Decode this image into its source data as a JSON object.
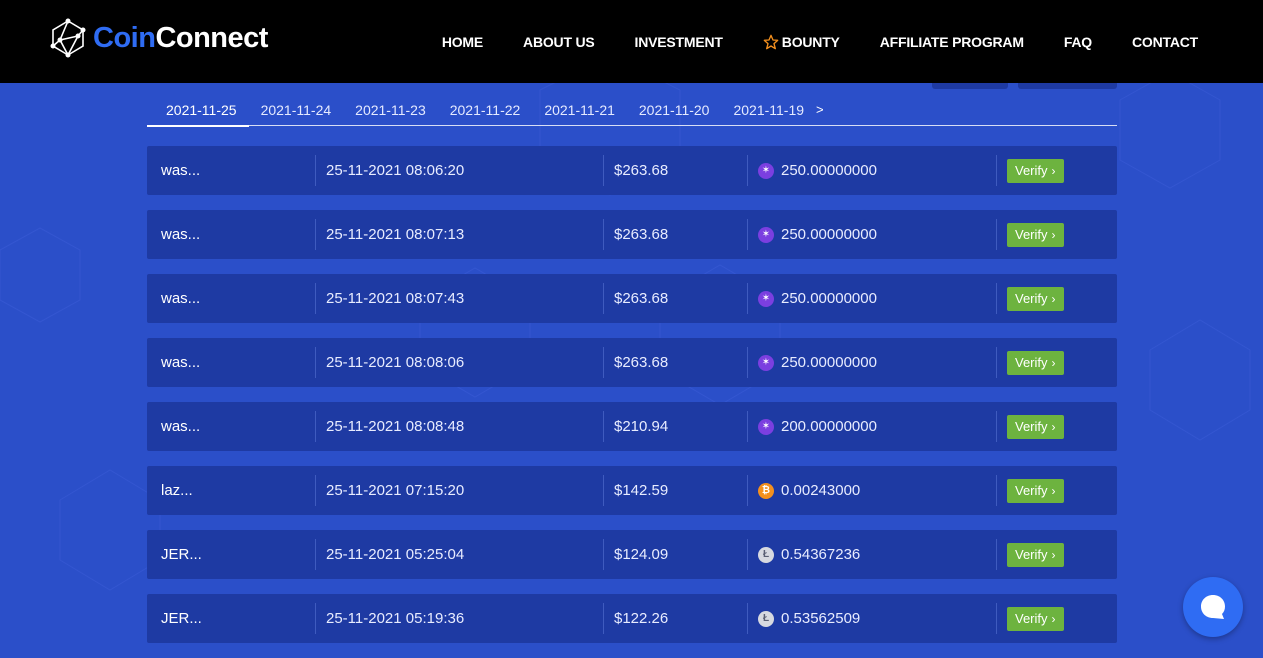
{
  "brand": {
    "part1": "Coin",
    "part2": "Connect"
  },
  "nav": [
    {
      "label": "HOME",
      "icon": ""
    },
    {
      "label": "ABOUT US",
      "icon": ""
    },
    {
      "label": "INVESTMENT",
      "icon": ""
    },
    {
      "label": "BOUNTY",
      "icon": "star-icon"
    },
    {
      "label": "AFFILIATE PROGRAM",
      "icon": ""
    },
    {
      "label": "FAQ",
      "icon": ""
    },
    {
      "label": "CONTACT",
      "icon": ""
    }
  ],
  "tabs": {
    "dates": [
      "2021-11-25",
      "2021-11-24",
      "2021-11-23",
      "2021-11-22",
      "2021-11-21",
      "2021-11-20",
      "2021-11-19"
    ],
    "active": "2021-11-25",
    "next_label": ">"
  },
  "transactions": [
    {
      "user": "was...",
      "time": "25-11-2021 08:06:20",
      "usd": "$263.68",
      "coin": "xlm",
      "amount": "250.00000000",
      "verify": "Verify"
    },
    {
      "user": "was...",
      "time": "25-11-2021 08:07:13",
      "usd": "$263.68",
      "coin": "xlm",
      "amount": "250.00000000",
      "verify": "Verify"
    },
    {
      "user": "was...",
      "time": "25-11-2021 08:07:43",
      "usd": "$263.68",
      "coin": "xlm",
      "amount": "250.00000000",
      "verify": "Verify"
    },
    {
      "user": "was...",
      "time": "25-11-2021 08:08:06",
      "usd": "$263.68",
      "coin": "xlm",
      "amount": "250.00000000",
      "verify": "Verify"
    },
    {
      "user": "was...",
      "time": "25-11-2021 08:08:48",
      "usd": "$210.94",
      "coin": "xlm",
      "amount": "200.00000000",
      "verify": "Verify"
    },
    {
      "user": "laz...",
      "time": "25-11-2021 07:15:20",
      "usd": "$142.59",
      "coin": "btc",
      "amount": "0.00243000",
      "verify": "Verify"
    },
    {
      "user": "JER...",
      "time": "25-11-2021 05:25:04",
      "usd": "$124.09",
      "coin": "ltc",
      "amount": "0.54367236",
      "verify": "Verify"
    },
    {
      "user": "JER...",
      "time": "25-11-2021 05:19:36",
      "usd": "$122.26",
      "coin": "ltc",
      "amount": "0.53562509",
      "verify": "Verify"
    }
  ],
  "coin_icons": {
    "xlm": "stellar-icon",
    "btc": "bitcoin-icon",
    "ltc": "litecoin-icon"
  },
  "colors": {
    "background": "#2b4fc9",
    "row": "#1e3aa3",
    "verify": "#6db33f",
    "brand_blue": "#2f6cf3",
    "navbar": "#000000"
  }
}
